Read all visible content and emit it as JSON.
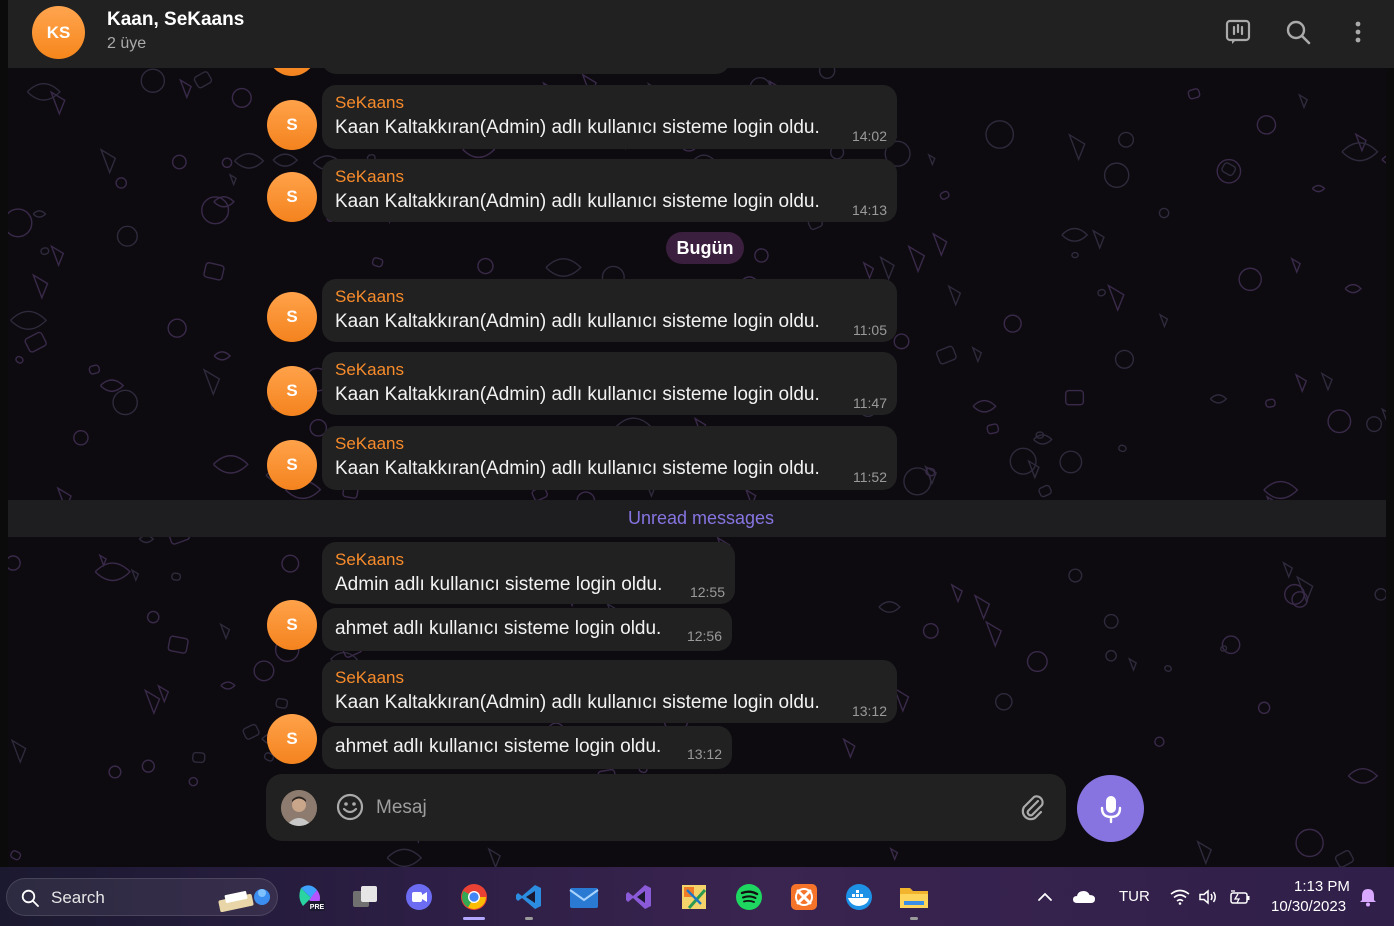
{
  "header": {
    "avatar_initials": "KS",
    "title": "Kaan, SeKaans",
    "subtitle": "2 üye",
    "icons": [
      "live-stream-icon",
      "search-icon",
      "more-vertical-icon"
    ]
  },
  "colors": {
    "accent": "#8774e1",
    "sender": "#f88b2a",
    "bubble": "#212121",
    "date_pill": "#3b1f3f"
  },
  "messages": [
    {
      "avatar": "S",
      "sender": "SeKaans",
      "text": "Kaan Kaltakkıran(Admin) adlı kullanıcı sisteme login oldu.",
      "time": "14:02"
    },
    {
      "avatar": "S",
      "sender": "SeKaans",
      "text": "Kaan Kaltakkıran(Admin) adlı kullanıcı sisteme login oldu.",
      "time": "14:13"
    },
    {
      "avatar": "S",
      "sender": "SeKaans",
      "text": "Kaan Kaltakkıran(Admin) adlı kullanıcı sisteme login oldu.",
      "time": "11:05"
    },
    {
      "avatar": "S",
      "sender": "SeKaans",
      "text": "Kaan Kaltakkıran(Admin) adlı kullanıcı sisteme login oldu.",
      "time": "11:47"
    },
    {
      "avatar": "S",
      "sender": "SeKaans",
      "text": "Kaan Kaltakkıran(Admin) adlı kullanıcı sisteme login oldu.",
      "time": "11:52"
    },
    {
      "sender": "SeKaans",
      "text": "Admin adlı kullanıcı sisteme login oldu.",
      "time": "12:55"
    },
    {
      "avatar": "S",
      "text": "ahmet adlı kullanıcı sisteme login oldu.",
      "time": "12:56"
    },
    {
      "sender": "SeKaans",
      "text": "Kaan Kaltakkıran(Admin) adlı kullanıcı sisteme login oldu.",
      "time": "13:12"
    },
    {
      "avatar": "S",
      "text": "ahmet adlı kullanıcı sisteme login oldu.",
      "time": "13:12"
    }
  ],
  "date_separator": "Bugün",
  "unread_label": "Unread messages",
  "composer": {
    "placeholder": "Mesaj"
  },
  "taskbar": {
    "search_label": "Search",
    "apps": [
      "copilot-icon",
      "task-view-icon",
      "discord-icon",
      "chrome-icon",
      "vscode-icon",
      "mail-icon",
      "visual-studio-icon",
      "paint-icon",
      "spotify-icon",
      "xampp-icon",
      "docker-icon",
      "file-explorer-icon"
    ],
    "language": "TUR",
    "time": "1:13 PM",
    "date": "10/30/2023"
  }
}
